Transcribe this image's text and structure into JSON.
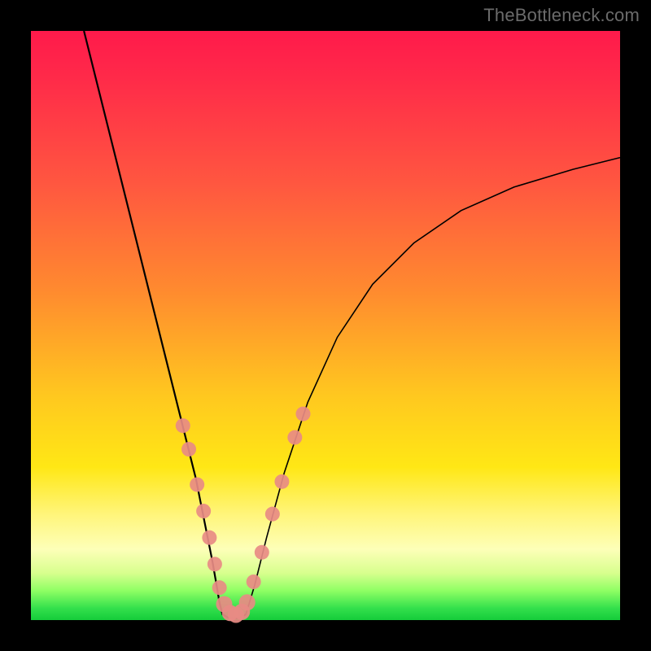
{
  "watermark": "TheBottleneck.com",
  "colors": {
    "frame": "#000000",
    "gradient_top": "#ff1a4b",
    "gradient_mid": "#ffe715",
    "gradient_bottom": "#15cc3a",
    "curve": "#000000",
    "dots": "#e88b84"
  },
  "chart_data": {
    "type": "line",
    "title": "",
    "xlabel": "",
    "ylabel": "",
    "xlim": [
      0,
      100
    ],
    "ylim": [
      0,
      100
    ],
    "series": [
      {
        "name": "left-branch",
        "x": [
          9,
          12,
          15,
          18,
          21,
          23,
          25,
          26.5,
          28,
          29,
          30,
          30.8,
          31.5,
          32,
          32.5
        ],
        "y": [
          100,
          88,
          76,
          64,
          52,
          44,
          36,
          30,
          24,
          19,
          14,
          10,
          6,
          3,
          1
        ]
      },
      {
        "name": "valley-floor",
        "x": [
          32.5,
          33.5,
          34.5,
          35.5,
          36.5
        ],
        "y": [
          1,
          0.4,
          0.3,
          0.4,
          1
        ]
      },
      {
        "name": "right-branch",
        "x": [
          36.5,
          38,
          40,
          43,
          47,
          52,
          58,
          65,
          73,
          82,
          92,
          100
        ],
        "y": [
          1,
          6,
          14,
          25,
          37,
          48,
          57,
          64,
          69.5,
          73.5,
          76.5,
          78.5
        ]
      }
    ],
    "scatter": [
      {
        "x": 25.8,
        "y": 33,
        "r": 9
      },
      {
        "x": 26.8,
        "y": 29,
        "r": 9
      },
      {
        "x": 28.2,
        "y": 23,
        "r": 9
      },
      {
        "x": 29.3,
        "y": 18.5,
        "r": 9
      },
      {
        "x": 30.3,
        "y": 14,
        "r": 9
      },
      {
        "x": 31.2,
        "y": 9.5,
        "r": 9
      },
      {
        "x": 32.0,
        "y": 5.5,
        "r": 9
      },
      {
        "x": 32.8,
        "y": 2.7,
        "r": 10
      },
      {
        "x": 33.8,
        "y": 1.2,
        "r": 10
      },
      {
        "x": 34.8,
        "y": 0.9,
        "r": 10
      },
      {
        "x": 35.8,
        "y": 1.4,
        "r": 10
      },
      {
        "x": 36.7,
        "y": 3.0,
        "r": 10
      },
      {
        "x": 37.8,
        "y": 6.5,
        "r": 9
      },
      {
        "x": 39.2,
        "y": 11.5,
        "r": 9
      },
      {
        "x": 41.0,
        "y": 18,
        "r": 9
      },
      {
        "x": 42.6,
        "y": 23.5,
        "r": 9
      },
      {
        "x": 44.8,
        "y": 31,
        "r": 9
      },
      {
        "x": 46.2,
        "y": 35,
        "r": 9
      }
    ]
  }
}
